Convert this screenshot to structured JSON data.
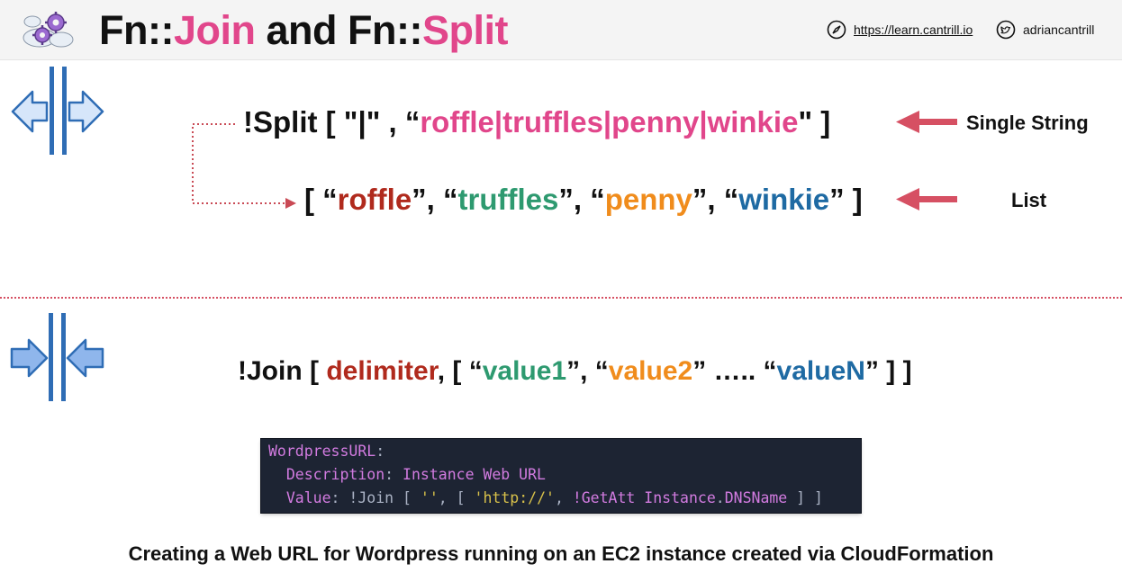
{
  "header": {
    "title_prefix_1": "Fn::",
    "title_join": "Join",
    "title_and": " and ",
    "title_prefix_2": "Fn::",
    "title_split": "Split",
    "website": "https://learn.cantrill.io",
    "twitter": "adriancantrill"
  },
  "split": {
    "expr": {
      "open": "!Split [ \"|\" , “",
      "string": "roffle|truffles|penny|winkie",
      "close": "\" ]"
    },
    "list": {
      "open": "[ “",
      "item1": "roffle",
      "sep1": "”, “",
      "item2": "truffles",
      "sep2": "”, “",
      "item3": "penny",
      "sep3": "”, “",
      "item4": "winkie",
      "close": "” ]"
    },
    "label_single": "Single String",
    "label_list": "List"
  },
  "join": {
    "open": "!Join [ ",
    "delimiter": "delimiter",
    "mid": ", [ “",
    "value1": "value1",
    "sep1": "”, “",
    "value2": "value2",
    "dots": "” ….. “",
    "valueN": "valueN",
    "close": "” ] ]"
  },
  "code": {
    "l1_key": "WordpressURL",
    "l1_colon": ":",
    "l2_indent": "  ",
    "l2_key": "Description",
    "l2_colon": ": ",
    "l2_val": "Instance Web URL",
    "l3_indent": "  ",
    "l3_key": "Value",
    "l3_colon": ": ",
    "l3_join": "!Join",
    "l3_b1": " [ ",
    "l3_empty": "''",
    "l3_b2": ", [ ",
    "l3_http": "'http://'",
    "l3_comma": ", ",
    "l3_getatt": "!GetAtt Instance",
    "l3_dot": ".",
    "l3_dns": "DNSName",
    "l3_end": " ] ]"
  },
  "caption": "Creating a Web URL for Wordpress running on an EC2 instance created via CloudFormation",
  "colors": {
    "pink": "#e1468b",
    "red": "#b02a1d",
    "green": "#2e9a70",
    "orange": "#f08c1c",
    "blue": "#1e6aa3",
    "arrow": "#d65063",
    "code_bg": "#1d2433"
  }
}
